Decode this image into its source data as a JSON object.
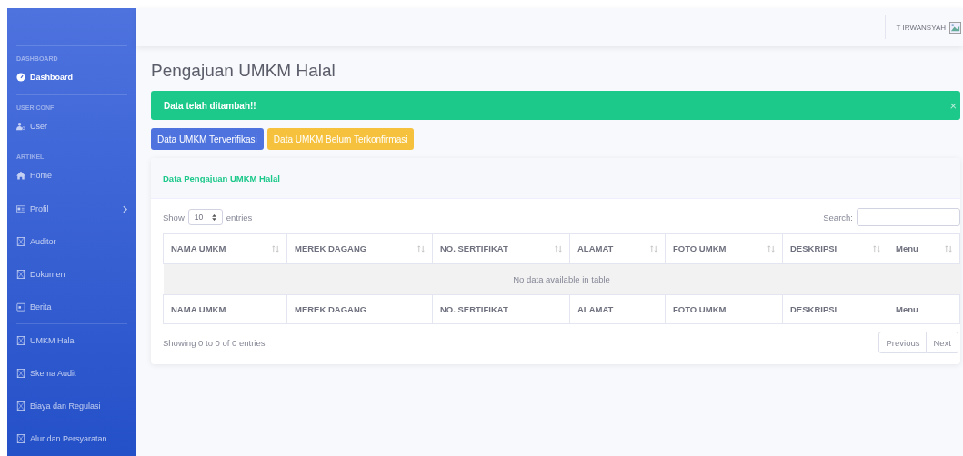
{
  "sidebar": {
    "sections": [
      {
        "heading": "DASHBOARD",
        "items": [
          {
            "label": "Dashboard",
            "kind": "gauge",
            "selected": true,
            "has_children": false
          }
        ]
      },
      {
        "heading": "USER CONF",
        "items": [
          {
            "label": "User",
            "kind": "user",
            "selected": false,
            "has_children": false
          }
        ]
      },
      {
        "heading": "ARTIKEL",
        "items": [
          {
            "label": "Home",
            "kind": "home",
            "selected": false,
            "has_children": false
          },
          {
            "label": "Profil",
            "kind": "card",
            "selected": false,
            "has_children": true
          },
          {
            "label": "Auditor",
            "kind": "generic",
            "selected": false,
            "has_children": false
          },
          {
            "label": "Dokumen",
            "kind": "generic",
            "selected": false,
            "has_children": false
          },
          {
            "label": "Berita",
            "kind": "calendar",
            "selected": false,
            "has_children": false
          }
        ]
      },
      {
        "items": [
          {
            "label": "UMKM Halal",
            "kind": "generic",
            "selected": false,
            "has_children": false
          },
          {
            "label": "Skema Audit",
            "kind": "generic",
            "selected": false,
            "has_children": false
          },
          {
            "label": "Biaya dan Regulasi",
            "kind": "generic",
            "selected": false,
            "has_children": false
          },
          {
            "label": "Alur dan Persyaratan",
            "kind": "generic",
            "selected": false,
            "has_children": false
          }
        ]
      }
    ]
  },
  "topbar": {
    "user_name": "T IRWANSYAH"
  },
  "page_title": "Pengajuan UMKM Halal",
  "alert": {
    "message": "Data telah ditambah!!",
    "close": "×"
  },
  "buttons": [
    {
      "label": "Data UMKM Terverifikasi",
      "kind": "primary"
    },
    {
      "label": "Data UMKM Belum Terkonfirmasi",
      "kind": "warning"
    }
  ],
  "card": {
    "title": "Data Pengajuan UMKM Halal",
    "length": {
      "before": "Show",
      "value": "10",
      "after": "entries"
    },
    "search": {
      "label": "Search:"
    },
    "table": {
      "columns": [
        "NAMA UMKM",
        "MEREK DAGANG",
        "NO. SERTIFIKAT",
        "ALAMAT",
        "FOTO UMKM",
        "DESKRIPSI",
        "Menu"
      ],
      "empty": "No data available in table",
      "footer": [
        "NAMA UMKM",
        "MEREK DAGANG",
        "NO. SERTIFIKAT",
        "ALAMAT",
        "FOTO UMKM",
        "DESKRIPSI",
        "Menu"
      ]
    },
    "info": "Showing 0 to 0 of 0 entries",
    "pagination": [
      "Previous",
      "Next"
    ]
  }
}
